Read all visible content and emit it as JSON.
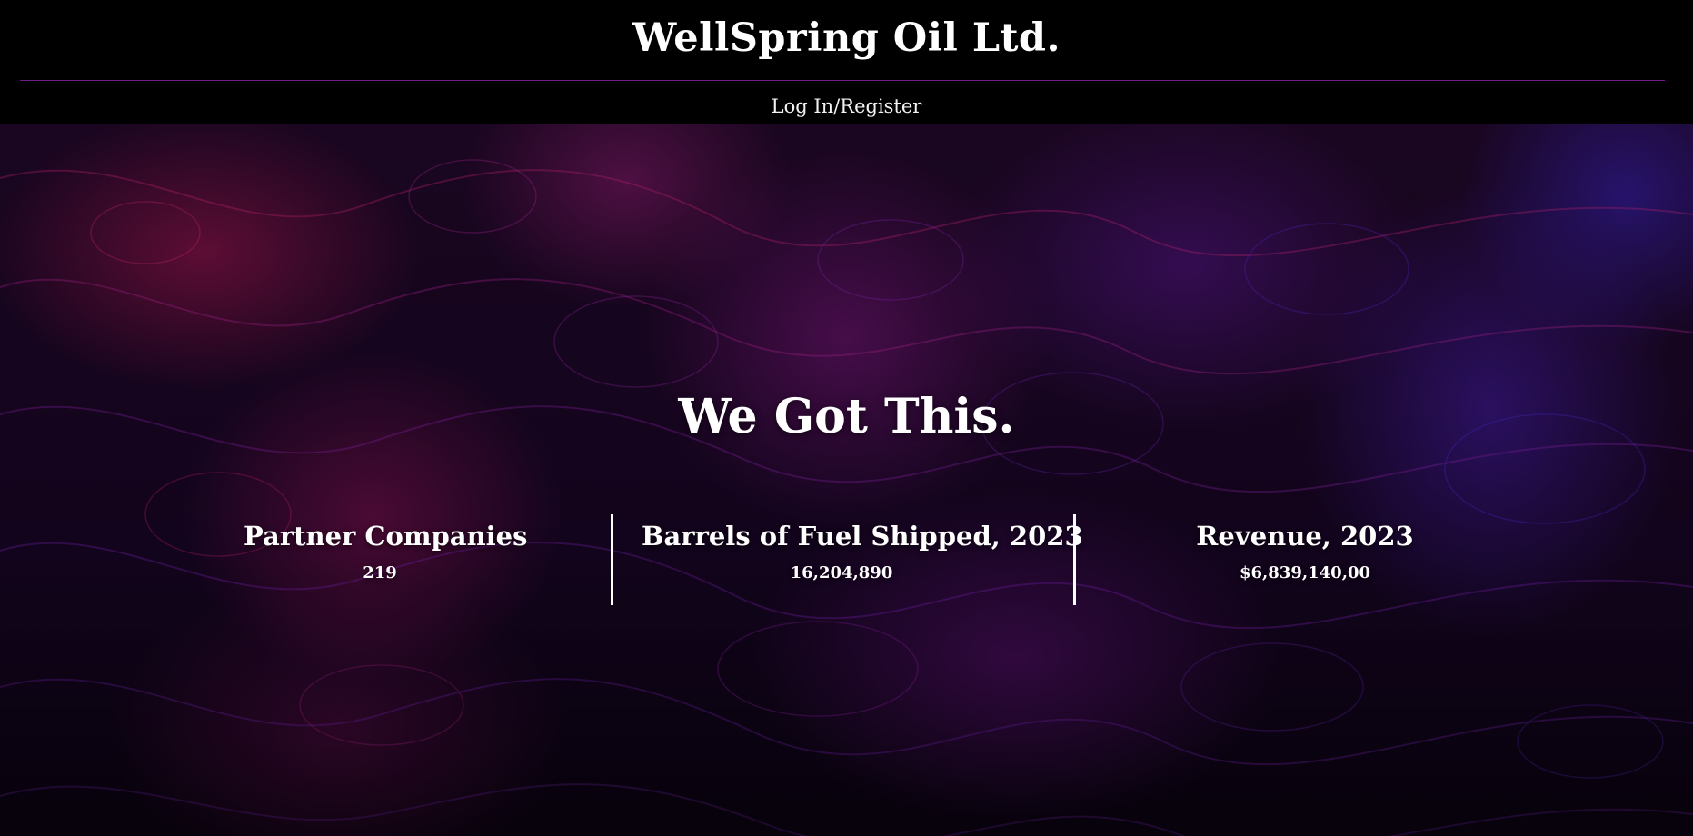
{
  "header": {
    "site_title": "WellSpring Oil Ltd.",
    "login_label": "Log In/Register",
    "rule_color": "#6e1d86"
  },
  "hero": {
    "tagline": "We Got This.",
    "stats": [
      {
        "label": "Partner Companies",
        "value": "219"
      },
      {
        "label": "Barrels of Fuel Shipped, 2023",
        "value": "16,204,890"
      },
      {
        "label": "Revenue, 2023",
        "value": "$6,839,140,00"
      }
    ]
  },
  "colors": {
    "background": "#000000",
    "text": "#ffffff",
    "accent_magenta": "#8a1d6e",
    "accent_purple": "#4a1aa0"
  }
}
